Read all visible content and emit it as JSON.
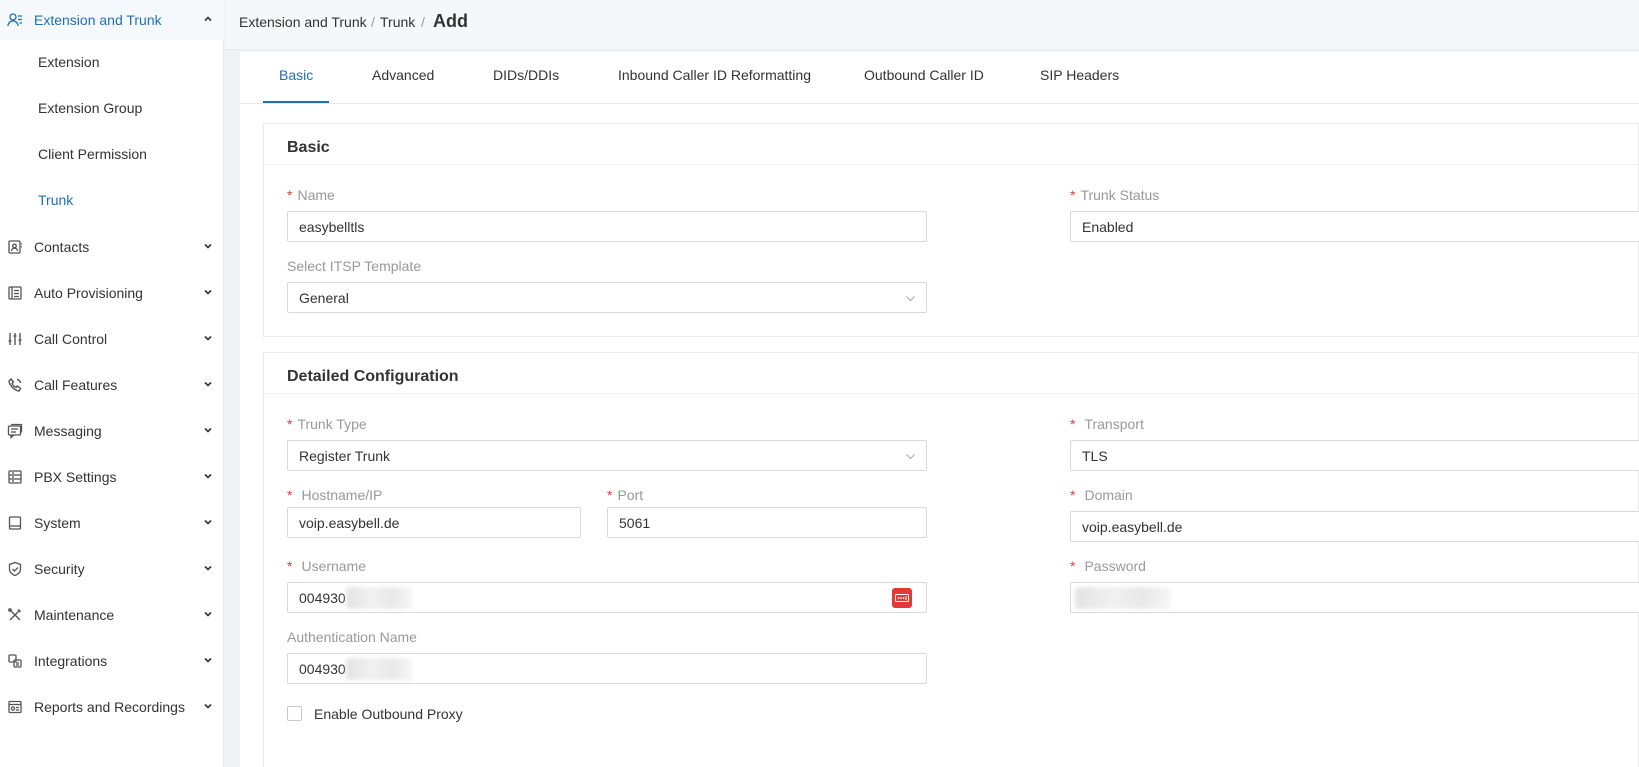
{
  "sidebar": {
    "active_group": "Extension and Trunk",
    "submenu": [
      "Extension",
      "Extension Group",
      "Client Permission",
      "Trunk"
    ],
    "active_sub": "Trunk",
    "groups": [
      {
        "label": "Extension and Trunk",
        "icon": "user-list-icon"
      },
      {
        "label": "Contacts",
        "icon": "contacts-book-icon"
      },
      {
        "label": "Auto Provisioning",
        "icon": "provisioning-icon"
      },
      {
        "label": "Call Control",
        "icon": "sliders-icon"
      },
      {
        "label": "Call Features",
        "icon": "phone-icon"
      },
      {
        "label": "Messaging",
        "icon": "chat-icon"
      },
      {
        "label": "PBX Settings",
        "icon": "settings-list-icon"
      },
      {
        "label": "System",
        "icon": "monitor-icon"
      },
      {
        "label": "Security",
        "icon": "shield-icon"
      },
      {
        "label": "Maintenance",
        "icon": "tools-icon"
      },
      {
        "label": "Integrations",
        "icon": "integration-icon"
      },
      {
        "label": "Reports and Recordings",
        "icon": "report-icon"
      }
    ]
  },
  "breadcrumb": {
    "items": [
      "Extension and Trunk",
      "Trunk"
    ],
    "separator": "/",
    "current": "Add"
  },
  "tabs": [
    "Basic",
    "Advanced",
    "DIDs/DDIs",
    "Inbound Caller ID Reformatting",
    "Outbound Caller ID",
    "SIP Headers"
  ],
  "active_tab": "Basic",
  "basic_section": {
    "title": "Basic",
    "name": {
      "label": "Name",
      "value": "easybelltls",
      "required": true
    },
    "trunk_status": {
      "label": "Trunk Status",
      "value": "Enabled",
      "required": true
    },
    "itsp_template": {
      "label": "Select ITSP Template",
      "value": "General"
    }
  },
  "detailed_section": {
    "title": "Detailed Configuration",
    "trunk_type": {
      "label": "Trunk Type",
      "value": "Register Trunk",
      "required": true
    },
    "transport": {
      "label": "Transport",
      "value": "TLS",
      "required": true
    },
    "hostname": {
      "label": "Hostname/IP",
      "value": "voip.easybell.de",
      "required": true
    },
    "port": {
      "label": "Port",
      "value": "5061",
      "required": true
    },
    "domain": {
      "label": "Domain",
      "value": "voip.easybell.de",
      "required": true
    },
    "username": {
      "label": "Username",
      "value": "004930",
      "required": true
    },
    "password": {
      "label": "Password",
      "required": true
    },
    "auth_name": {
      "label": "Authentication Name",
      "value": "004930"
    },
    "outbound_proxy": {
      "label": "Enable Outbound Proxy",
      "checked": false
    }
  },
  "colors": {
    "accent": "#1f6fb5",
    "required": "#e53935",
    "password_manager_badge": "#e53935"
  }
}
